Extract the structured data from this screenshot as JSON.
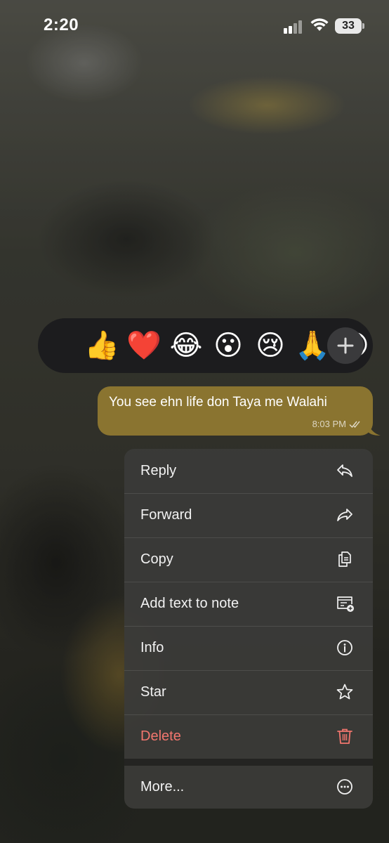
{
  "status_bar": {
    "time": "2:20",
    "battery": "33"
  },
  "reactions": {
    "emojis": [
      "👍",
      "❤️",
      "😂",
      "😮",
      "😢",
      "🙏",
      "😍"
    ],
    "add_icon": "plus-icon"
  },
  "message": {
    "text": "You see ehn life don Taya me Walahi",
    "time": "8:03 PM",
    "status_icon": "double-check-icon"
  },
  "menu": {
    "items": [
      {
        "label": "Reply",
        "icon": "reply-icon"
      },
      {
        "label": "Forward",
        "icon": "forward-icon"
      },
      {
        "label": "Copy",
        "icon": "copy-icon"
      },
      {
        "label": "Add text to note",
        "icon": "note-add-icon"
      },
      {
        "label": "Info",
        "icon": "info-icon"
      },
      {
        "label": "Star",
        "icon": "star-icon"
      },
      {
        "label": "Delete",
        "icon": "trash-icon"
      },
      {
        "label": "More...",
        "icon": "more-icon"
      }
    ]
  },
  "colors": {
    "bubble": "#8a7430",
    "danger": "#f2766e",
    "menu_bg": "#3a3a38"
  }
}
